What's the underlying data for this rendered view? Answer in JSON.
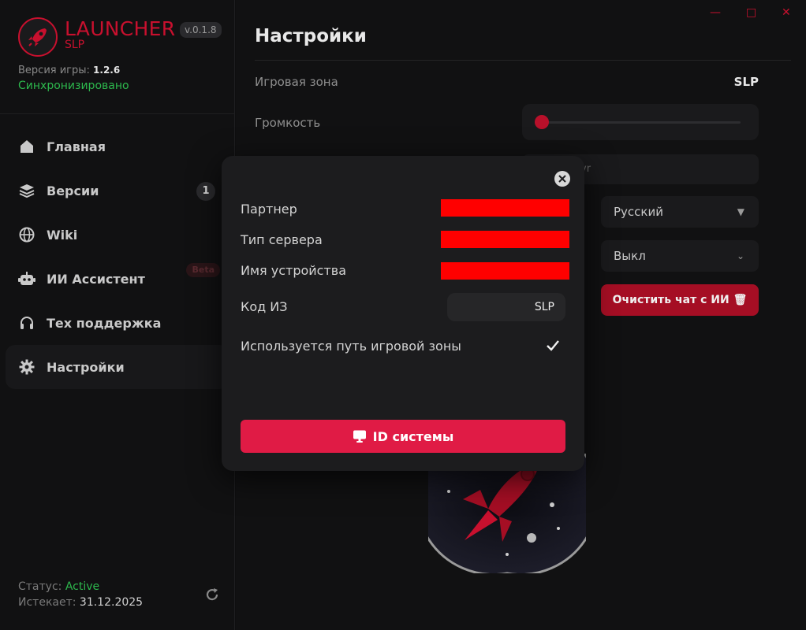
{
  "colors": {
    "accent": "#c8102e",
    "success": "#2db84d",
    "button": "#e01b45",
    "redaction": "#ff0000"
  },
  "brand": {
    "name": "LAUNCHER",
    "sub": "SLP",
    "version": "v.0.1.8"
  },
  "game": {
    "version_label": "Версия игры:",
    "version_value": "1.2.6",
    "sync_status": "Синхронизировано"
  },
  "nav": [
    {
      "label": "Главная",
      "icon": "home-icon"
    },
    {
      "label": "Версии",
      "icon": "layers-icon",
      "badge": "1"
    },
    {
      "label": "Wiki",
      "icon": "globe-icon"
    },
    {
      "label": "ИИ Ассистент",
      "icon": "robot-icon",
      "tag": "Beta"
    },
    {
      "label": "Тех поддержка",
      "icon": "headphones-icon"
    },
    {
      "label": "Настройки",
      "icon": "gear-icon",
      "active": true
    }
  ],
  "footer": {
    "status_label": "Статус:",
    "status_value": "Active",
    "expires_label": "Истекает:",
    "expires_value": "31.12.2025"
  },
  "settings": {
    "title": "Настройки",
    "zone_label": "Игровая зона",
    "zone_value": "SLP",
    "volume_label": "Громкость",
    "volume_level": 0.0,
    "path_fragment": "vr",
    "language_value": "Русский",
    "toggle_value": "Выкл",
    "clear_chat_label": "Очистить чат с ИИ"
  },
  "modal": {
    "partner_label": "Партнер",
    "server_type_label": "Тип сервера",
    "device_name_label": "Имя устройства",
    "code_label": "Код ИЗ",
    "code_value": "SLP",
    "path_used_label": "Используется путь игровой зоны",
    "id_button_label": "ID системы"
  }
}
